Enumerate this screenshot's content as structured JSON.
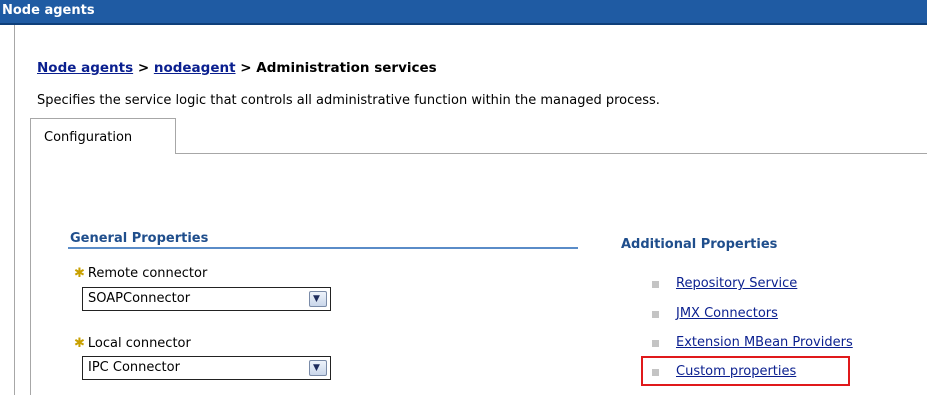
{
  "header": {
    "title": "Node agents"
  },
  "breadcrumb": {
    "link1": "Node agents",
    "link2": "nodeagent",
    "sep": " > ",
    "current": "Administration services"
  },
  "description": "Specifies the service logic that controls all administrative function within the managed process.",
  "tabs": [
    {
      "label": "Configuration"
    }
  ],
  "general_properties": {
    "title": "General Properties",
    "remote_connector": {
      "label": "Remote connector",
      "value": "SOAPConnector"
    },
    "local_connector": {
      "label": "Local connector",
      "value": "IPC Connector"
    }
  },
  "additional_properties": {
    "title": "Additional Properties",
    "links": [
      {
        "label": "Repository Service"
      },
      {
        "label": "JMX Connectors"
      },
      {
        "label": "Extension MBean Providers"
      },
      {
        "label": "Custom properties"
      }
    ]
  },
  "colors": {
    "header_bg": "#1f5ba3",
    "link": "#0a1f8f",
    "section_title": "#1f4e8c",
    "highlight": "#e0191b"
  },
  "icons": {
    "required": "asterisk-icon",
    "dropdown": "chevron-down-icon",
    "bullet": "square-bullet-icon"
  }
}
